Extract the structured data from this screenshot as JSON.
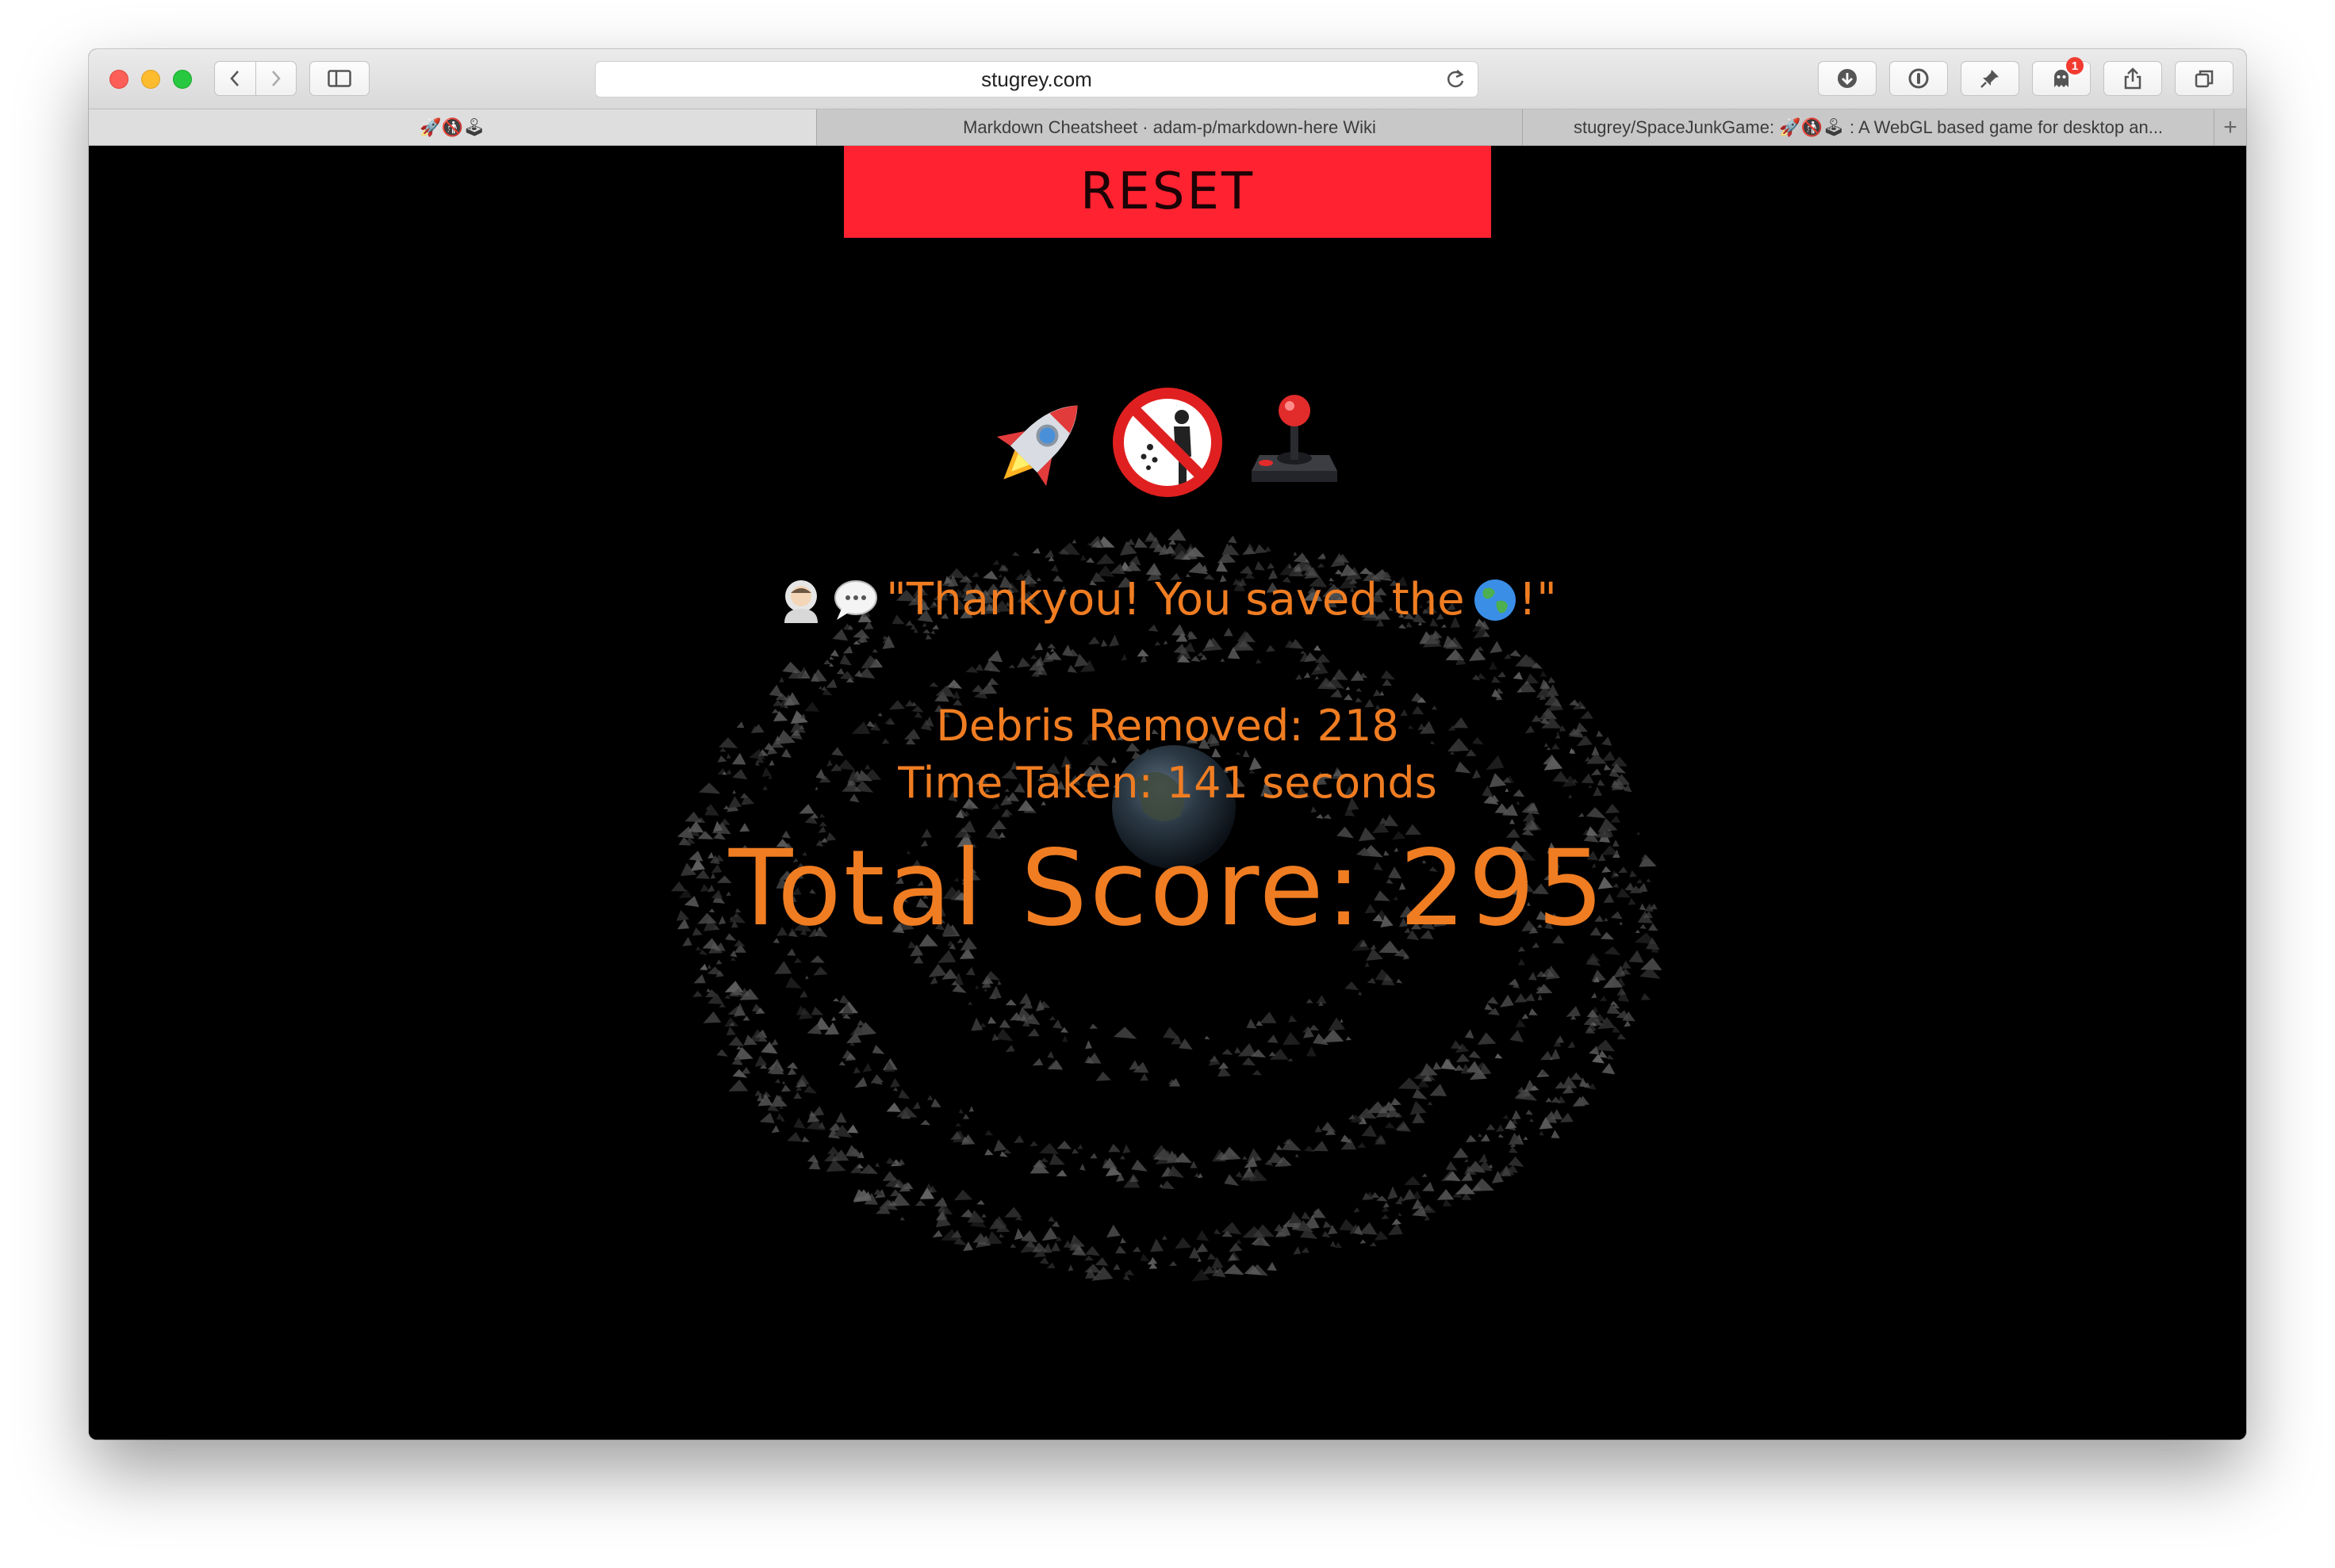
{
  "browser": {
    "url": "stugrey.com",
    "notification_count": "1",
    "tabs": [
      {
        "label": "🚀🚯🕹"
      },
      {
        "label": "Markdown Cheatsheet · adam-p/markdown-here Wiki"
      },
      {
        "label": "stugrey/SpaceJunkGame: 🚀🚯🕹 : A WebGL based game for desktop an..."
      }
    ],
    "new_tab_label": "+"
  },
  "game": {
    "reset_label": "RESET",
    "logo_icons": [
      "rocket",
      "no-littering",
      "joystick"
    ],
    "message": "\"Thankyou! You saved the ",
    "message_end": "!\"",
    "debris": "Debris Removed: 218",
    "time": "Time Taken: 141 seconds",
    "score": "Total Score: 295",
    "accent_color": "#f07d22",
    "reset_color": "#ff2230"
  }
}
